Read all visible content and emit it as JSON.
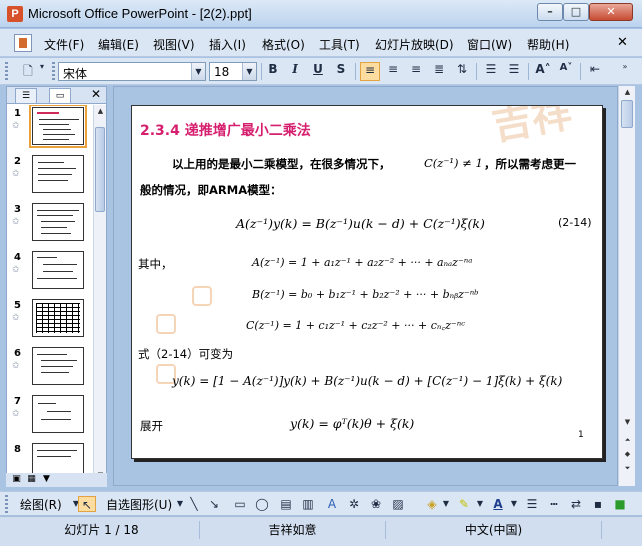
{
  "window": {
    "title": "Microsoft Office PowerPoint - [2(2).ppt]",
    "min": "–",
    "max": "□",
    "close": "✕"
  },
  "menu": {
    "items": [
      "文件(F)",
      "编辑(E)",
      "视图(V)",
      "插入(I)",
      "格式(O)",
      "工具(T)",
      "幻灯片放映(D)",
      "窗口(W)",
      "帮助(H)"
    ],
    "close": "✕"
  },
  "format_toolbar": {
    "font": "宋体",
    "size": "18",
    "bold": "B",
    "italic": "I",
    "underline": "U",
    "shadow": "S"
  },
  "left_panel": {
    "slide_numbers": [
      "1",
      "2",
      "3",
      "4",
      "5",
      "6",
      "7",
      "8"
    ],
    "close": "✕"
  },
  "slide": {
    "heading": "2.3.4 递推增广最小二乘法",
    "intro_line1": "以上用的是最小二乘模型，在很多情况下，",
    "intro_cond": "C(z⁻¹) ≠ 1",
    "intro_line1b": "，所以需考虑更一",
    "intro_line2": "般的情况，即ARMA模型：",
    "eq_main": "A(z⁻¹)y(k) = B(z⁻¹)u(k − d) + C(z⁻¹)ξ(k)",
    "eq_number": "(2-14)",
    "where_label": "其中，",
    "eq_A": "A(z⁻¹) = 1 + a₁z⁻¹ + a₂z⁻² + ··· + aₙₐz⁻ⁿᵃ",
    "eq_B": "B(z⁻¹) = b₀ + b₁z⁻¹ + b₂z⁻² + ··· + bₙᵦz⁻ⁿᵇ",
    "eq_C": "C(z⁻¹) = 1 + c₁z⁻¹ + c₂z⁻² + ··· + cₙ꜀z⁻ⁿᶜ",
    "rewrite_label": "式（2-14）可变为",
    "eq_rewrite": "y(k) = [1 − A(z⁻¹)]y(k) + B(z⁻¹)u(k − d) + [C(z⁻¹) − 1]ξ(k) + ξ(k)",
    "expand_label": "展开",
    "eq_expand": "y(k) = φᵀ(k)θ + ξ(k)",
    "page_number": "1",
    "watermark": "吉祥"
  },
  "draw_toolbar": {
    "draw_label": "绘图(R)",
    "autoshape_label": "自选图形(U)"
  },
  "status": {
    "slide_info": "幻灯片 1 / 18",
    "design": "吉祥如意",
    "language": "中文(中国)"
  },
  "colors": {
    "heading": "#d61f6e",
    "chrome": "#dbe6f4",
    "workspace": "#a9c3e3"
  }
}
